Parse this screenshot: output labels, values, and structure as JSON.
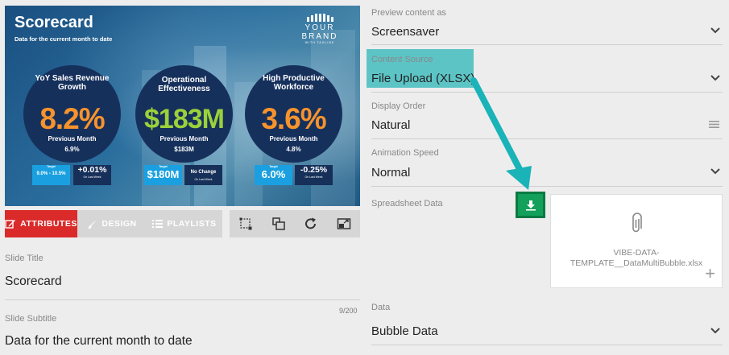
{
  "slide": {
    "title": "Scorecard",
    "subtitle": "Data for the current month to date",
    "brand": "YOUR BRAND",
    "brand_tagline": "WITH TAGLINE",
    "bubbles": [
      {
        "label": "YoY Sales Revenue Growth",
        "value": "8.2%",
        "prev_label": "Previous Month",
        "prev_value": "6.9%",
        "target_label": "Target",
        "target_value": "9.0% - 10.5%",
        "change_value": "+0.01%",
        "change_sub": "On Last Week"
      },
      {
        "label": "Operational Effectiveness",
        "value": "$183M",
        "prev_label": "Previous Month",
        "prev_value": "$183M",
        "target_label": "Target",
        "target_value": "$180M",
        "change_value": "No Change",
        "change_sub": "On Last Week"
      },
      {
        "label": "High Productive Workforce",
        "value": "3.6%",
        "prev_label": "Previous Month",
        "prev_value": "4.8%",
        "target_label": "Target",
        "target_value": "6.0%",
        "change_value": "-0.25%",
        "change_sub": "On Last Week"
      }
    ],
    "colors": {
      "bubble_bg": "#16305c",
      "value_orange": "#f6932d",
      "value_green": "#9bd13a",
      "target_blue": "#1aa0e0"
    }
  },
  "tabs": {
    "attributes": "ATTRIBUTES",
    "design": "DESIGN",
    "playlists": "PLAYLISTS",
    "active_color": "#da2a2a"
  },
  "tools": [
    "crop-icon",
    "layers-icon",
    "refresh-icon",
    "screen-share-icon"
  ],
  "left_form": {
    "slide_title_label": "Slide Title",
    "slide_title_value": "Scorecard",
    "slide_subtitle_label": "Slide Subtitle",
    "slide_subtitle_value": "Data for the current month to date",
    "subtitle_char_count": "9/200"
  },
  "right_form": {
    "preview_label": "Preview content as",
    "preview_value": "Screensaver",
    "content_source_label": "Content Source",
    "content_source_value": "File Upload (XLSX)",
    "display_order_label": "Display Order",
    "display_order_value": "Natural",
    "animation_speed_label": "Animation Speed",
    "animation_speed_value": "Normal",
    "spreadsheet_label": "Spreadsheet Data",
    "spreadsheet_file": "VIBE-DATA-TEMPLATE__DataMultiBubble.xlsx",
    "data_label": "Data",
    "data_value": "Bubble Data",
    "highlight_color": "#5dc4c6",
    "download_color": "#12a05a"
  }
}
